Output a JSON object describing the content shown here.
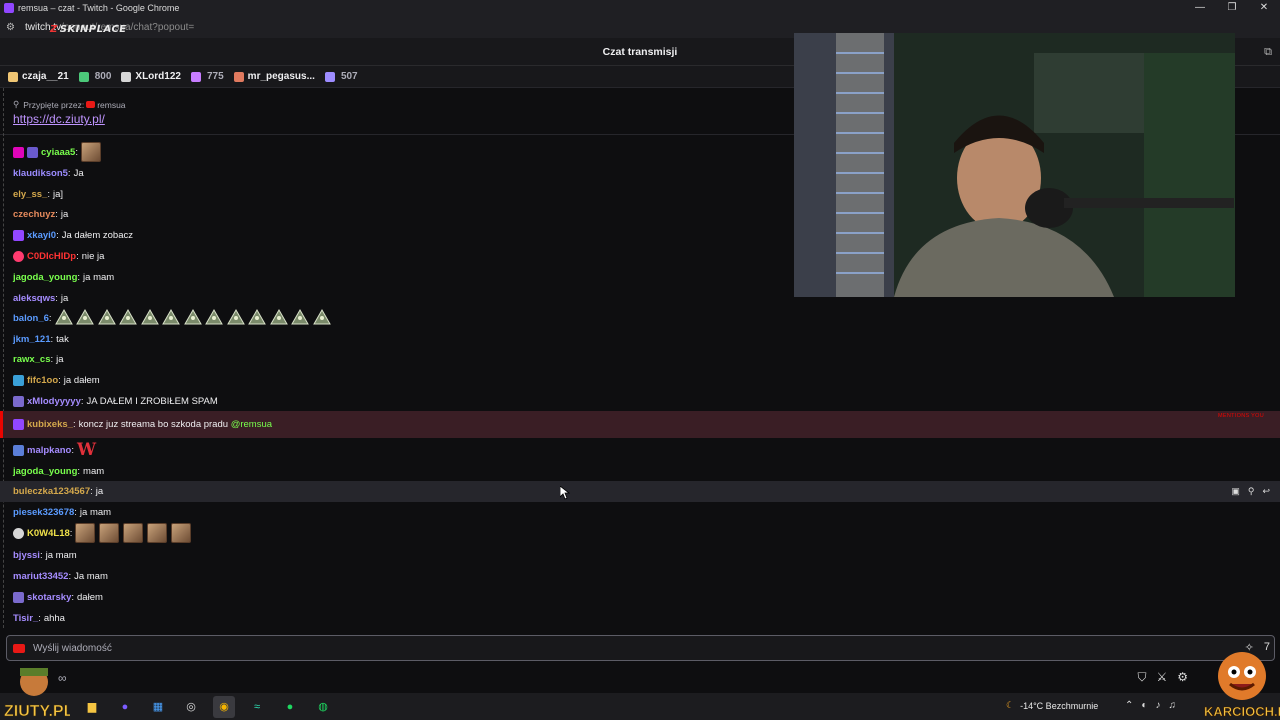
{
  "window": {
    "title": "remsua – czat - Twitch - Google Chrome"
  },
  "address": {
    "host": "twitch.tv",
    "path": "/popout/remsua/chat?popout="
  },
  "overlay_brand": "SKINPLACE",
  "chat": {
    "header": "Czat transmisji",
    "leaderboard": [
      {
        "user": "czaja__21",
        "count": "",
        "color": "#f0c674"
      },
      {
        "user": "",
        "count": "800",
        "color": "#4cc97a"
      },
      {
        "user": "XLord122",
        "count": "",
        "color": "#d6d6d6"
      },
      {
        "user": "",
        "count": "775",
        "color": "#c77dff"
      },
      {
        "user": "mr_pegasus...",
        "count": "",
        "color": "#e07a5f"
      },
      {
        "user": "",
        "count": "507",
        "color": "#9d8cff"
      }
    ],
    "pinned": {
      "label": "Przypięte przez:",
      "by": "remsua",
      "link": "https://dc.ziuty.pl/"
    },
    "messages": [
      {
        "user": "cyiaaa5",
        "text": "",
        "color": "#79ff4d",
        "sep": ":"
      },
      {
        "user": "klaudikson5",
        "text": "Ja",
        "color": "#9c8cff",
        "sep": ":"
      },
      {
        "user": "ely_ss_",
        "text": "ja]",
        "color": "#d4a84c",
        "sep": ":"
      },
      {
        "user": "czechuyz",
        "text": "ja",
        "color": "#e58a5c",
        "sep": ":"
      },
      {
        "user": "xkayi0",
        "text": "Ja dałem zobacz",
        "color": "#5b9bff",
        "sep": ":"
      },
      {
        "user": "C0DIcHIDp",
        "text": "nie ja",
        "color": "#ff3333",
        "sep": ":"
      },
      {
        "user": "jagoda_young",
        "text": "ja mam",
        "color": "#79ff4d",
        "sep": ":"
      },
      {
        "user": "aleksqws",
        "text": "ja",
        "color": "#a58cff",
        "sep": ":"
      },
      {
        "user": "balon_6",
        "text": "",
        "color": "#5b9bff",
        "sep": ":"
      },
      {
        "user": "jkm_121",
        "text": "tak",
        "color": "#5b9bff",
        "sep": ":"
      },
      {
        "user": "rawx_cs",
        "text": "ja",
        "color": "#79ff4d",
        "sep": ":"
      },
      {
        "user": "fifc1oo",
        "text": "ja dałem",
        "color": "#d4a84c",
        "sep": ":"
      },
      {
        "user": "xMlodyyyyy",
        "text": "JA DAŁEM I ZROBIŁEM SPAM",
        "color": "#a58cff",
        "sep": ":"
      },
      {
        "user": "kubixeks_",
        "text": "koncz juz streama bo szkoda pradu",
        "mention": "@remsua",
        "color": "#d4a84c",
        "sep": ":"
      },
      {
        "user": "malpkano",
        "text": "",
        "color": "#a58cff",
        "sep": ":"
      },
      {
        "user": "jagoda_young",
        "text": "mam",
        "color": "#79ff4d",
        "sep": ":"
      },
      {
        "user": "buleczka1234567",
        "text": "ja",
        "color": "#d4a84c",
        "sep": ":"
      },
      {
        "user": "piesek323678",
        "text": "ja mam",
        "color": "#5b9bff",
        "sep": ":"
      },
      {
        "user": "K0W4L18",
        "text": "",
        "color": "#f0e14a",
        "sep": ":"
      },
      {
        "user": "bjyssi",
        "text": "ja mam",
        "color": "#a58cff",
        "sep": ":"
      },
      {
        "user": "mariut33452",
        "text": "Ja mam",
        "color": "#a58cff",
        "sep": ":"
      },
      {
        "user": "skotarsky",
        "text": "dałem",
        "color": "#a58cff",
        "sep": ":"
      },
      {
        "user": "Tisir_",
        "text": "ahha",
        "color": "#a58cff",
        "sep": ":"
      }
    ],
    "mention_tag": "MENTIONS YOU",
    "emote_big": "W",
    "input_placeholder": "Wyślij wiadomość",
    "infinity": "∞"
  },
  "taskbar": {
    "weather": "-14°C  Bezchmurnie"
  },
  "logos": {
    "left": "ZIUTY.PL",
    "right": "KARCIOCH.PL"
  }
}
